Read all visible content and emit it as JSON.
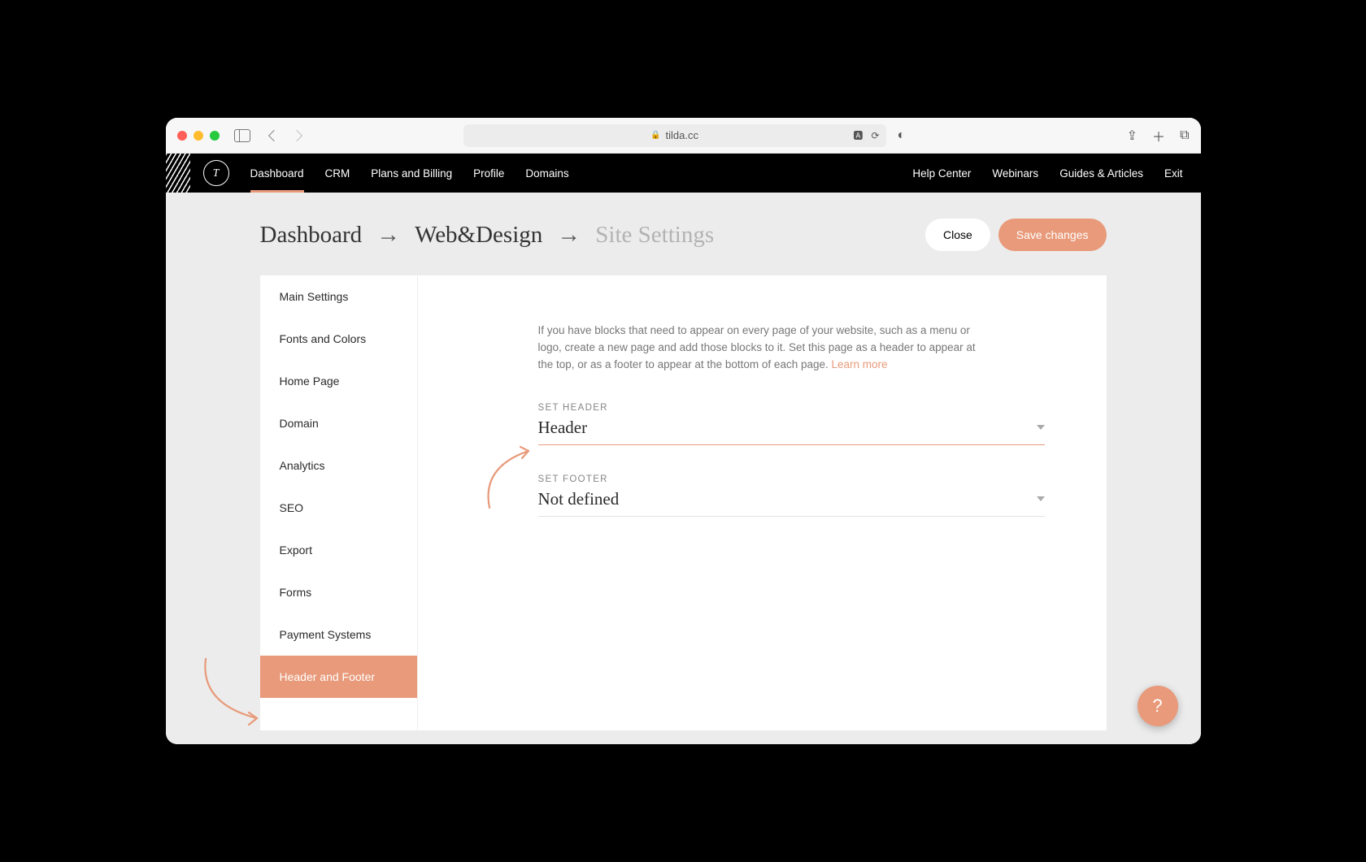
{
  "browser": {
    "url_host": "tilda.cc"
  },
  "topnav": {
    "items": [
      "Dashboard",
      "CRM",
      "Plans and Billing",
      "Profile",
      "Domains"
    ],
    "active_index": 0,
    "right": [
      "Help Center",
      "Webinars",
      "Guides & Articles",
      "Exit"
    ]
  },
  "breadcrumb": {
    "a": "Dashboard",
    "b": "Web&Design",
    "c": "Site Settings"
  },
  "actions": {
    "close": "Close",
    "save": "Save changes"
  },
  "sidemenu": {
    "items": [
      "Main Settings",
      "Fonts and Colors",
      "Home Page",
      "Domain",
      "Analytics",
      "SEO",
      "Export",
      "Forms",
      "Payment Systems",
      "Header and Footer"
    ],
    "active_index": 9
  },
  "content": {
    "intro": "If you have blocks that need to appear on every page of your website, such as a menu or logo, create a new page and add those blocks to it. Set this page as a header to appear at the top, or as a footer to appear at the bottom of each page. ",
    "learn_more": "Learn more",
    "set_header_label": "SET HEADER",
    "set_header_value": "Header",
    "set_footer_label": "SET FOOTER",
    "set_footer_value": "Not defined"
  },
  "help_fab": "?"
}
